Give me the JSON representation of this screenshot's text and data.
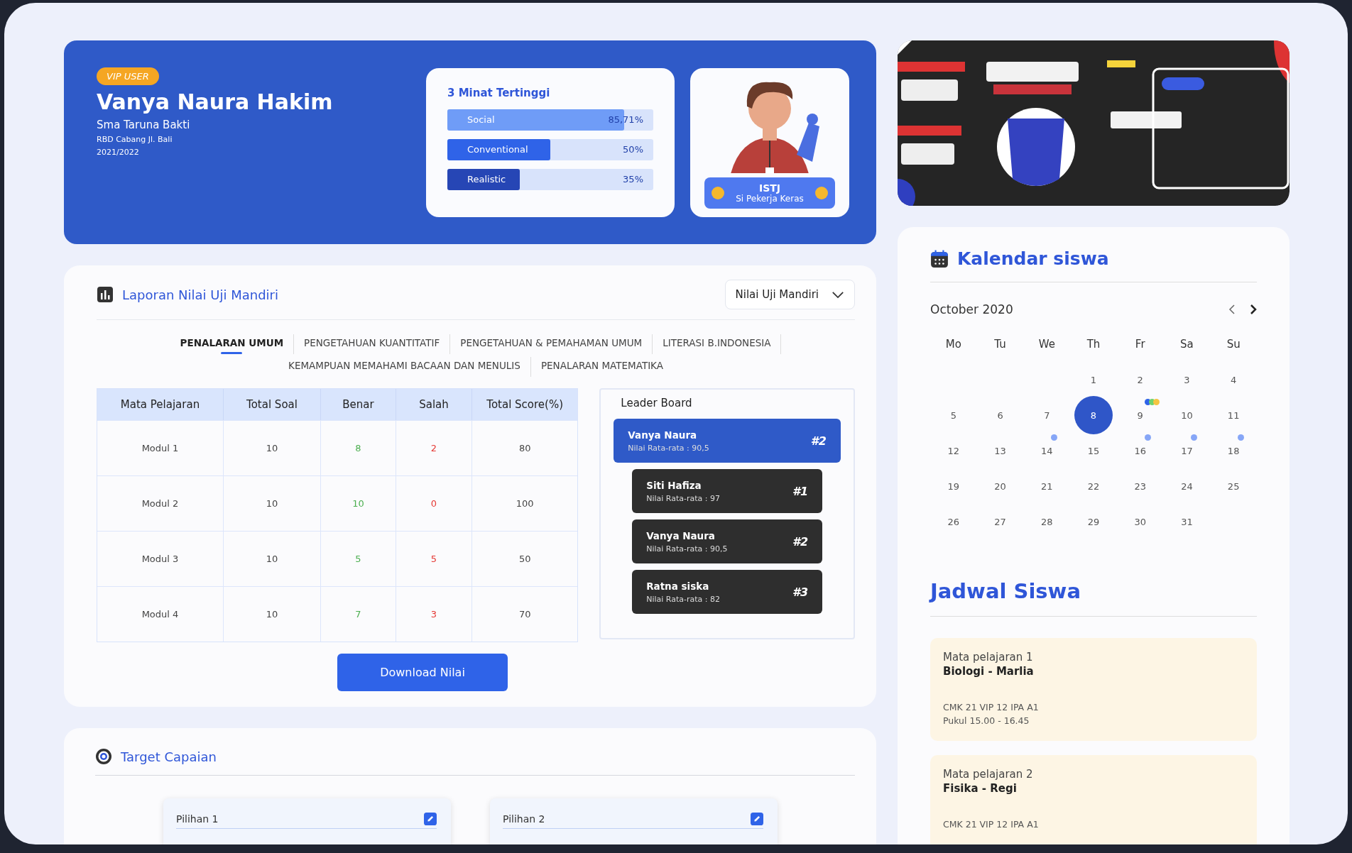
{
  "profile": {
    "badge": "VIP USER",
    "name": "Vanya Naura Hakim",
    "school": "Sma Taruna Bakti",
    "branch": "RBD Cabang Jl. Bali",
    "year": "2021/2022"
  },
  "interests": {
    "title": "3 Minat Tertinggi",
    "items": [
      {
        "label": "Social",
        "reading": "85,71%",
        "level": 0.857,
        "color": "#6f9cf7"
      },
      {
        "label": "Conventional",
        "reading": "50%",
        "level": 0.5,
        "color": "#2f63e8"
      },
      {
        "label": "Realistic",
        "reading": "35%",
        "level": 0.35,
        "color": "#2646b5"
      }
    ]
  },
  "personality": {
    "code": "ISTJ",
    "subtitle": "Si Pekerja Keras"
  },
  "report": {
    "title": "Laporan Nilai Uji Mandiri",
    "dropdown": "Nilai Uji Mandiri",
    "tabs": [
      {
        "label": "PENALARAN UMUM",
        "selected": true
      },
      {
        "label": "PENGETAHUAN KUANTITATIF",
        "selected": false
      },
      {
        "label": "PENGETAHUAN & PEMAHAMAN UMUM",
        "selected": false
      },
      {
        "label": "LITERASI B.INDONESIA",
        "selected": false
      },
      {
        "label": "KEMAMPUAN MEMAHAMI BACAAN DAN MENULIS",
        "selected": false
      },
      {
        "label": "PENALARAN MATEMATIKA",
        "selected": false
      }
    ],
    "table": {
      "columns": [
        "Mata Pelajaran",
        "Total Soal",
        "Benar",
        "Salah",
        "Total Score(%)"
      ],
      "rows": [
        [
          "Modul 1",
          "10",
          "8",
          "2",
          "80"
        ],
        [
          "Modul 2",
          "10",
          "10",
          "0",
          "100"
        ],
        [
          "Modul 3",
          "10",
          "5",
          "5",
          "50"
        ],
        [
          "Modul 4",
          "10",
          "7",
          "3",
          "70"
        ]
      ]
    },
    "leaderboard": {
      "title": "Leader Board",
      "entries": [
        {
          "name": "Vanya Naura",
          "score": "Nilai Rata-rata : 90,5",
          "rank": "#2",
          "selected": true
        },
        {
          "name": "Siti Hafiza",
          "score": "Nilai Rata-rata : 97",
          "rank": "#1",
          "selected": false
        },
        {
          "name": "Vanya Naura",
          "score": "Nilai Rata-rata : 90,5",
          "rank": "#2",
          "selected": false
        },
        {
          "name": "Ratna siska",
          "score": "Nilai Rata-rata : 82",
          "rank": "#3",
          "selected": false
        }
      ]
    },
    "download_button": "Download Nilai"
  },
  "target": {
    "title": "Target Capaian",
    "choices": [
      {
        "label": "Pilihan 1"
      },
      {
        "label": "Pilihan 2"
      }
    ]
  },
  "calendar": {
    "title": "Kalendar siswa",
    "month": "October 2020",
    "weekdays": [
      "Mo",
      "Tu",
      "We",
      "Th",
      "Fr",
      "Sa",
      "Su"
    ],
    "weeks": [
      [
        {
          "day": "1",
          "selected": false
        },
        {
          "day": "2",
          "selected": false
        },
        {
          "day": "3",
          "selected": false
        },
        {
          "day": "4",
          "selected": false
        }
      ],
      [
        {
          "day": "5",
          "selected": false
        },
        {
          "day": "6",
          "selected": false
        },
        {
          "day": "7",
          "selected": false
        },
        {
          "day": "8",
          "selected": true
        },
        {
          "day": "9",
          "selected": false,
          "dots": [
            {
              "color": "#2f63e8"
            },
            {
              "color": "#6fd36f"
            },
            {
              "color": "#f5c542"
            }
          ]
        },
        {
          "day": "10",
          "selected": false
        },
        {
          "day": "11",
          "selected": false
        }
      ],
      [
        {
          "day": "12",
          "selected": false
        },
        {
          "day": "13",
          "selected": false
        },
        {
          "day": "14",
          "selected": false,
          "dots": [
            {
              "color": "#86a6f7"
            }
          ]
        },
        {
          "day": "15",
          "selected": false
        },
        {
          "day": "16",
          "selected": false,
          "dots": [
            {
              "color": "#86a6f7"
            }
          ]
        },
        {
          "day": "17",
          "selected": false,
          "dots": [
            {
              "color": "#86a6f7"
            }
          ]
        },
        {
          "day": "18",
          "selected": false,
          "dots": [
            {
              "color": "#86a6f7"
            }
          ]
        }
      ],
      [
        {
          "day": "19",
          "selected": false
        },
        {
          "day": "20",
          "selected": false
        },
        {
          "day": "21",
          "selected": false
        },
        {
          "day": "22",
          "selected": false
        },
        {
          "day": "23",
          "selected": false
        },
        {
          "day": "24",
          "selected": false
        },
        {
          "day": "25",
          "selected": false
        }
      ],
      [
        {
          "day": "26",
          "selected": false
        },
        {
          "day": "27",
          "selected": false
        },
        {
          "day": "28",
          "selected": false
        },
        {
          "day": "29",
          "selected": false
        },
        {
          "day": "30",
          "selected": false
        },
        {
          "day": "31",
          "selected": false
        }
      ]
    ]
  },
  "schedule": {
    "title": "Jadwal Siswa",
    "items": [
      {
        "label": "Mata pelajaran 1",
        "subject": "Biologi - Marlia",
        "room": "CMK 21 VIP 12 IPA A1",
        "time": "Pukul 15.00 - 16.45"
      },
      {
        "label": "Mata pelajaran 2",
        "subject": "Fisika - Regi",
        "room": "CMK 21 VIP 12 IPA A1"
      }
    ]
  }
}
